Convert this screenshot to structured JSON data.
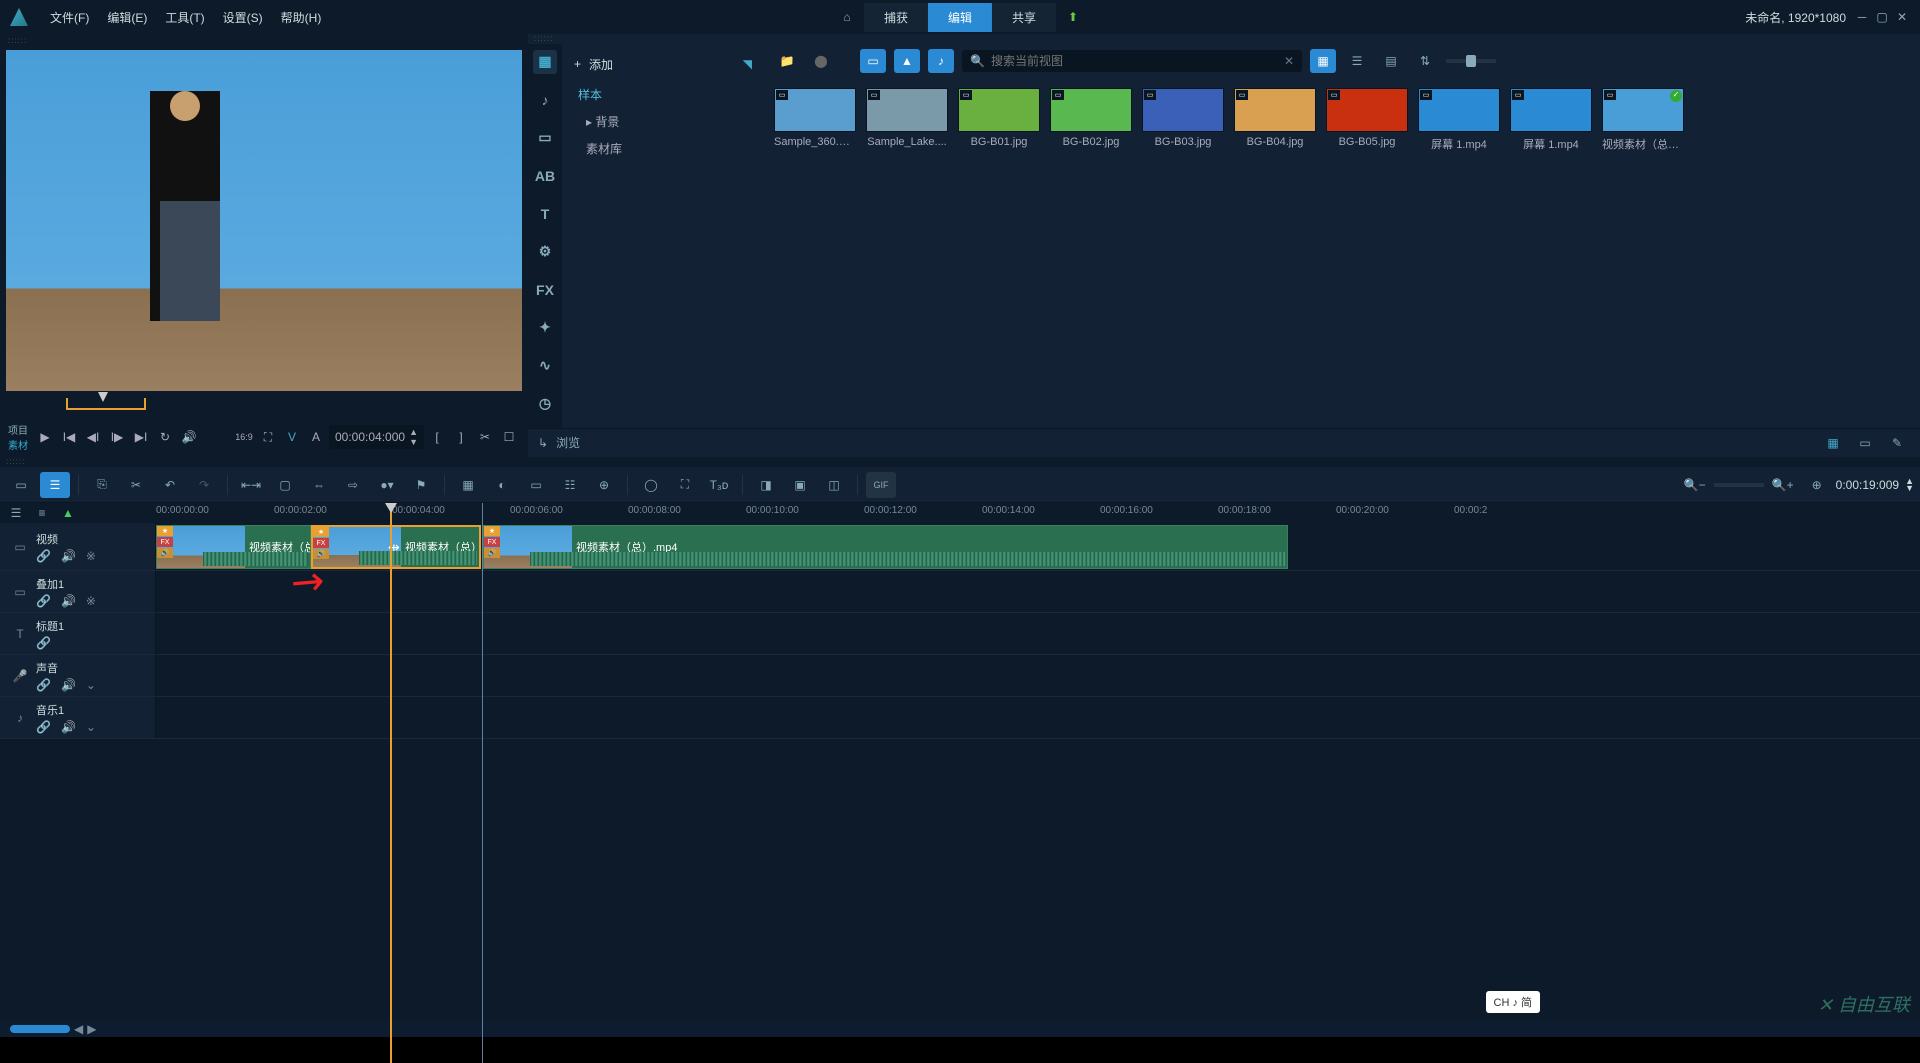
{
  "title_right": "未命名, 1920*1080",
  "menu": {
    "file": "文件(F)",
    "edit": "编辑(E)",
    "tools": "工具(T)",
    "settings": "设置(S)",
    "help": "帮助(H)"
  },
  "tabs": {
    "capture": "捕获",
    "edit": "编辑",
    "share": "共享"
  },
  "preview": {
    "project_label": "项目",
    "clip_label": "素材",
    "timecode": "00:00:04:000",
    "aspect": "16:9",
    "mark_in": "[",
    "mark_out": "]"
  },
  "library": {
    "add": "添加",
    "tree": {
      "sample": "样本",
      "background": "背景",
      "library": "素材库"
    },
    "search_placeholder": "搜索当前视图",
    "browse": "浏览",
    "items": [
      {
        "name": "Sample_360.m...",
        "bg": "#5a9ed0"
      },
      {
        "name": "Sample_Lake....",
        "bg": "#7a9aaa"
      },
      {
        "name": "BG-B01.jpg",
        "bg": "#6ab040"
      },
      {
        "name": "BG-B02.jpg",
        "bg": "#5ab850"
      },
      {
        "name": "BG-B03.jpg",
        "bg": "#3a60b8"
      },
      {
        "name": "BG-B04.jpg",
        "bg": "#d8a050"
      },
      {
        "name": "BG-B05.jpg",
        "bg": "#c83010"
      },
      {
        "name": "屏幕 1.mp4",
        "bg": "#2a8ad4"
      },
      {
        "name": "屏幕 1.mp4",
        "bg": "#2a8ad4"
      },
      {
        "name": "视频素材（总）....",
        "bg": "#4a9ed8"
      }
    ]
  },
  "timeline": {
    "timecode": "0:00:19:009",
    "ruler": [
      "00:00:00:00",
      "00:00:02:00",
      "00:00:04:00",
      "00:00:06:00",
      "00:00:08:00",
      "00:00:10:00",
      "00:00:12:00",
      "00:00:14:00",
      "00:00:16:00",
      "00:00:18:00",
      "00:00:20:00",
      "00:00:2"
    ],
    "tracks": {
      "video": "视频",
      "overlay": "叠加1",
      "title": "标题1",
      "voice": "声音",
      "music": "音乐1"
    },
    "clip_label_short": "视频素材（总",
    "clip_label_mid": "视频素材（总）",
    "clip_label_long": "视频素材（总）.mp4"
  },
  "ime": "CH ♪ 简",
  "watermark": "自由互联"
}
